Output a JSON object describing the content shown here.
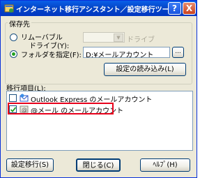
{
  "window": {
    "title": "インターネット移行アシスタント／設定移行ツール",
    "help_button": "?",
    "close_button": "X"
  },
  "save_location": {
    "group_label": "保存先",
    "removable_label": "リムーバブル",
    "drive_label": "ドライブ(Y):",
    "drive_combo_value": "",
    "drive_suffix": "ドライブ",
    "folder_label": "フォルダを指定(F):",
    "folder_value": "D:¥メールアカウント",
    "browse_button": "...",
    "load_settings_button": "設定の読み込み(L)"
  },
  "items": {
    "group_label": "移行項目(L):",
    "list": [
      {
        "label": "Outlook Express のメールアカウント",
        "checked": false,
        "icon": "outlook-express-icon"
      },
      {
        "label": "@メール のメールアカウント",
        "checked": true,
        "icon": "atmail-icon"
      }
    ]
  },
  "buttons": {
    "migrate": "設定移行(S)",
    "close": "閉じる(C)",
    "help": "ﾍﾙﾌﾟ(H)"
  },
  "colors": {
    "titlebar": "#0447c8",
    "dialog_bg": "#ece9d8",
    "highlight": "#e8001c"
  }
}
